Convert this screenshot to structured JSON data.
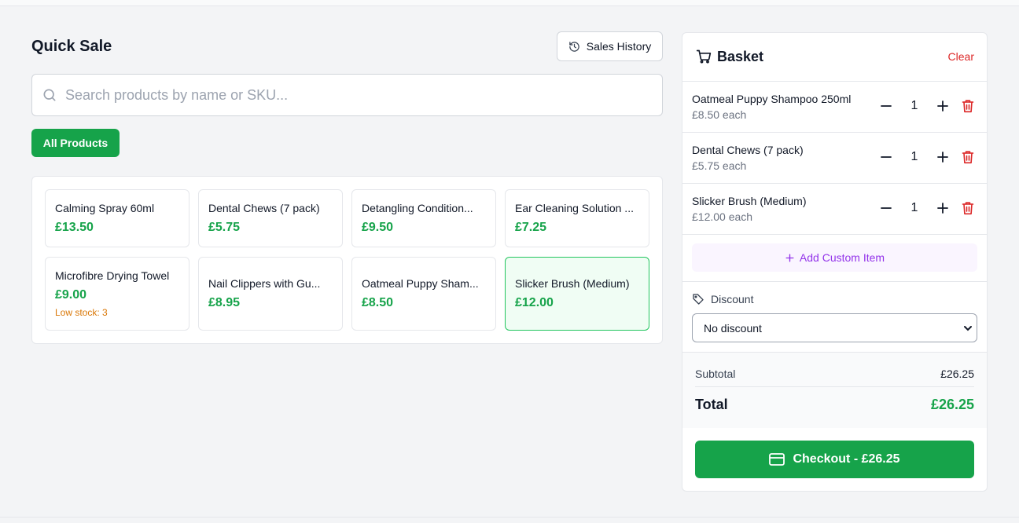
{
  "page": {
    "title": "Quick Sale"
  },
  "toolbar": {
    "history_label": "Sales History"
  },
  "search": {
    "placeholder": "Search products by name or SKU...",
    "value": ""
  },
  "filters": {
    "active_label": "All Products"
  },
  "products": [
    {
      "name": "Calming Spray 60ml",
      "price": "£13.50",
      "stock_note": ""
    },
    {
      "name": "Dental Chews (7 pack)",
      "price": "£5.75",
      "stock_note": ""
    },
    {
      "name": "Detangling Condition...",
      "price": "£9.50",
      "stock_note": ""
    },
    {
      "name": "Ear Cleaning Solution ...",
      "price": "£7.25",
      "stock_note": ""
    },
    {
      "name": "Microfibre Drying Towel",
      "price": "£9.00",
      "stock_note": "Low stock: 3"
    },
    {
      "name": "Nail Clippers with Gu...",
      "price": "£8.95",
      "stock_note": ""
    },
    {
      "name": "Oatmeal Puppy Sham...",
      "price": "£8.50",
      "stock_note": ""
    },
    {
      "name": "Slicker Brush (Medium)",
      "price": "£12.00",
      "stock_note": "",
      "selected": true
    }
  ],
  "basket": {
    "title": "Basket",
    "clear_label": "Clear",
    "items": [
      {
        "name": "Oatmeal Puppy Shampoo 250ml",
        "unit": "£8.50 each",
        "qty": "1"
      },
      {
        "name": "Dental Chews (7 pack)",
        "unit": "£5.75 each",
        "qty": "1"
      },
      {
        "name": "Slicker Brush (Medium)",
        "unit": "£12.00 each",
        "qty": "1"
      }
    ],
    "custom_item_label": "Add Custom Item",
    "discount_label": "Discount",
    "discount_value": "No discount",
    "subtotal_label": "Subtotal",
    "subtotal_value": "£26.25",
    "total_label": "Total",
    "total_value": "£26.25",
    "checkout_label": "Checkout - £26.25"
  },
  "colors": {
    "accent": "#16a34a",
    "danger": "#dc2626",
    "custom": "#9333ea",
    "warning": "#d97706"
  },
  "icons": {
    "history": "history-icon",
    "search": "search-icon",
    "cart": "cart-icon",
    "minus": "minus-icon",
    "plus": "plus-icon",
    "trash": "trash-icon",
    "tag": "tag-icon",
    "card": "credit-card-icon"
  }
}
